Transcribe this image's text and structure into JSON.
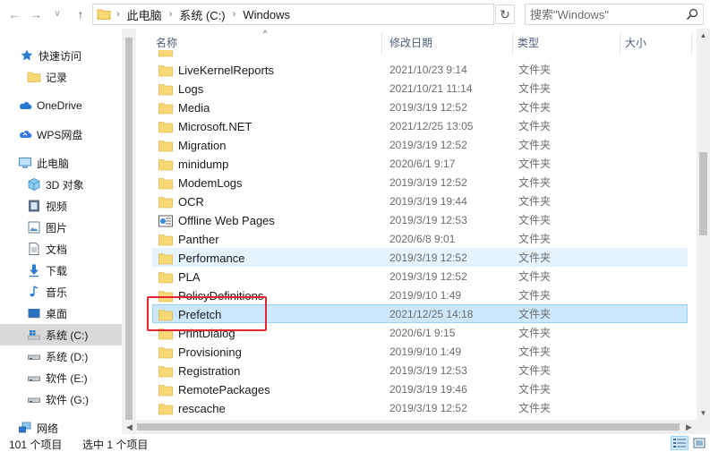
{
  "address": {
    "crumbs": [
      "此电脑",
      "系统 (C:)",
      "Windows"
    ],
    "refresh_icon": "refresh-icon"
  },
  "search": {
    "placeholder": "搜索\"Windows\""
  },
  "sidebar": {
    "items": [
      {
        "label": "快速访问",
        "icon": "star-icon"
      },
      {
        "label": "记录",
        "icon": "folder-icon"
      },
      {
        "label": "OneDrive",
        "icon": "cloud-icon"
      },
      {
        "label": "WPS网盘",
        "icon": "wps-cloud-icon"
      },
      {
        "label": "此电脑",
        "icon": "computer-icon"
      },
      {
        "label": "3D 对象",
        "icon": "cube-icon"
      },
      {
        "label": "视频",
        "icon": "video-icon"
      },
      {
        "label": "图片",
        "icon": "picture-icon"
      },
      {
        "label": "文档",
        "icon": "document-icon"
      },
      {
        "label": "下载",
        "icon": "download-icon"
      },
      {
        "label": "音乐",
        "icon": "music-icon"
      },
      {
        "label": "桌面",
        "icon": "desktop-icon"
      },
      {
        "label": "系统 (C:)",
        "icon": "system-drive-icon"
      },
      {
        "label": "系统 (D:)",
        "icon": "drive-icon"
      },
      {
        "label": "软件 (E:)",
        "icon": "drive-icon"
      },
      {
        "label": "软件 (G:)",
        "icon": "drive-icon"
      },
      {
        "label": "网络",
        "icon": "network-icon"
      }
    ],
    "selected_index": 12
  },
  "columns": {
    "name": "名称",
    "date": "修改日期",
    "type": "类型",
    "size": "大小"
  },
  "files": [
    {
      "name": "LiveKernelReports",
      "date": "2021/10/23 9:14",
      "type": "文件夹"
    },
    {
      "name": "Logs",
      "date": "2021/10/21 11:14",
      "type": "文件夹"
    },
    {
      "name": "Media",
      "date": "2019/3/19 12:52",
      "type": "文件夹"
    },
    {
      "name": "Microsoft.NET",
      "date": "2021/12/25 13:05",
      "type": "文件夹"
    },
    {
      "name": "Migration",
      "date": "2019/3/19 12:52",
      "type": "文件夹"
    },
    {
      "name": "minidump",
      "date": "2020/6/1 9:17",
      "type": "文件夹"
    },
    {
      "name": "ModemLogs",
      "date": "2019/3/19 12:52",
      "type": "文件夹"
    },
    {
      "name": "OCR",
      "date": "2019/3/19 19:44",
      "type": "文件夹"
    },
    {
      "name": "Offline Web Pages",
      "date": "2019/3/19 12:53",
      "type": "文件夹",
      "special": true
    },
    {
      "name": "Panther",
      "date": "2020/6/8 9:01",
      "type": "文件夹"
    },
    {
      "name": "Performance",
      "date": "2019/3/19 12:52",
      "type": "文件夹"
    },
    {
      "name": "PLA",
      "date": "2019/3/19 12:52",
      "type": "文件夹"
    },
    {
      "name": "PolicyDefinitions",
      "date": "2019/9/10 1:49",
      "type": "文件夹"
    },
    {
      "name": "Prefetch",
      "date": "2021/12/25 14:18",
      "type": "文件夹"
    },
    {
      "name": "PrintDialog",
      "date": "2020/6/1 9:15",
      "type": "文件夹"
    },
    {
      "name": "Provisioning",
      "date": "2019/9/10 1:49",
      "type": "文件夹"
    },
    {
      "name": "Registration",
      "date": "2019/3/19 12:53",
      "type": "文件夹"
    },
    {
      "name": "RemotePackages",
      "date": "2019/3/19 19:46",
      "type": "文件夹"
    },
    {
      "name": "rescache",
      "date": "2019/3/19 12:52",
      "type": "文件夹"
    }
  ],
  "hover_index": 10,
  "selected_file_index": 13,
  "status": {
    "count": "101 个项目",
    "selection": "选中 1 个项目"
  },
  "colors": {
    "selected_bg": "#cce8ff",
    "hover_bg": "#e5f3ff",
    "folder": "#f8d775",
    "highlight_box": "#e0262e"
  }
}
